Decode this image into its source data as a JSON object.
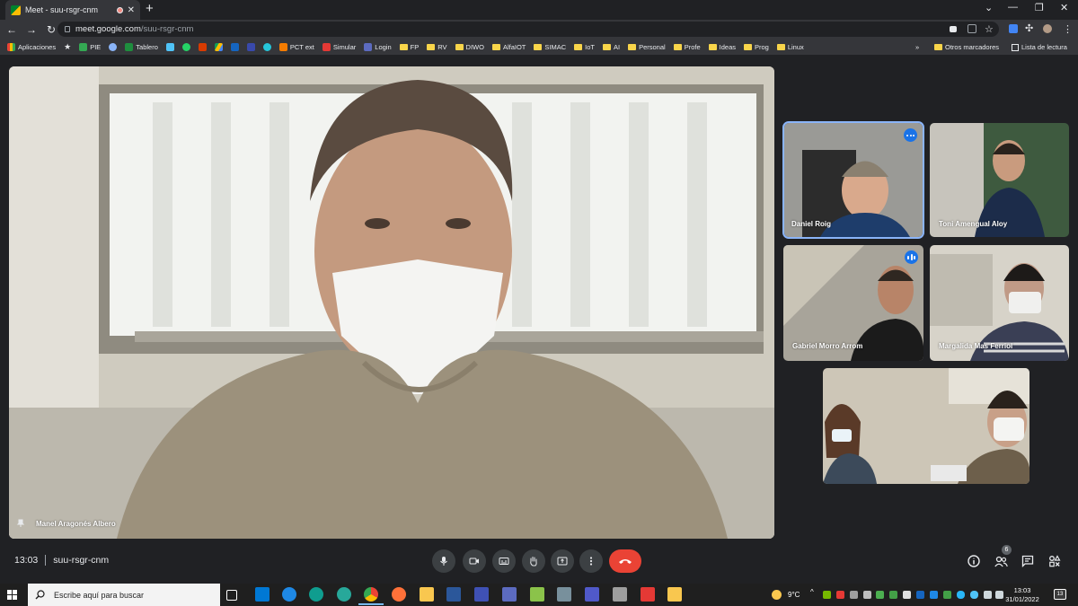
{
  "browser": {
    "tab_title": "Meet - suu-rsgr-cnm",
    "url_host": "meet.google.com",
    "url_path": "/suu-rsgr-cnm",
    "bookmarks": [
      "Aplicaciones",
      "PIE",
      "Tablero",
      "PCT ext",
      "Simular",
      "Login",
      "FP",
      "RV",
      "DIWO",
      "AlfaIOT",
      "SIMAC",
      "IoT",
      "AI",
      "Personal",
      "Profe",
      "Ideas",
      "Prog",
      "Linux"
    ],
    "other_bookmarks": "Otros marcadores",
    "reading_list": "Lista de lectura",
    "overflow": "»"
  },
  "meet": {
    "main_speaker": "Manel Aragonés Albero",
    "participants": [
      {
        "name": "Daniel Roig"
      },
      {
        "name": "Toni Amengual Aloy"
      },
      {
        "name": "Gabriel Morro Arrom"
      },
      {
        "name": "Margalida Mas Ferriol"
      }
    ],
    "time": "13:03",
    "meeting_code": "suu-rsgr-cnm",
    "people_count": "6"
  },
  "taskbar": {
    "search_placeholder": "Escribe aquí para buscar",
    "temperature": "9°C",
    "clock_time": "13:03",
    "clock_date": "31/01/2022",
    "notif_count": "13"
  },
  "icons": {
    "mic": "microphone-icon",
    "camera": "camera-icon",
    "captions": "captions-icon",
    "hand": "raise-hand-icon",
    "present": "present-screen-icon",
    "more": "more-options-icon",
    "end_call": "end-call-icon",
    "info": "info-icon",
    "people": "people-icon",
    "chat": "chat-icon",
    "activities": "activities-icon"
  },
  "colors": {
    "end_call": "#ea4335",
    "accent": "#1a73e8",
    "meet_bg": "#202124"
  }
}
